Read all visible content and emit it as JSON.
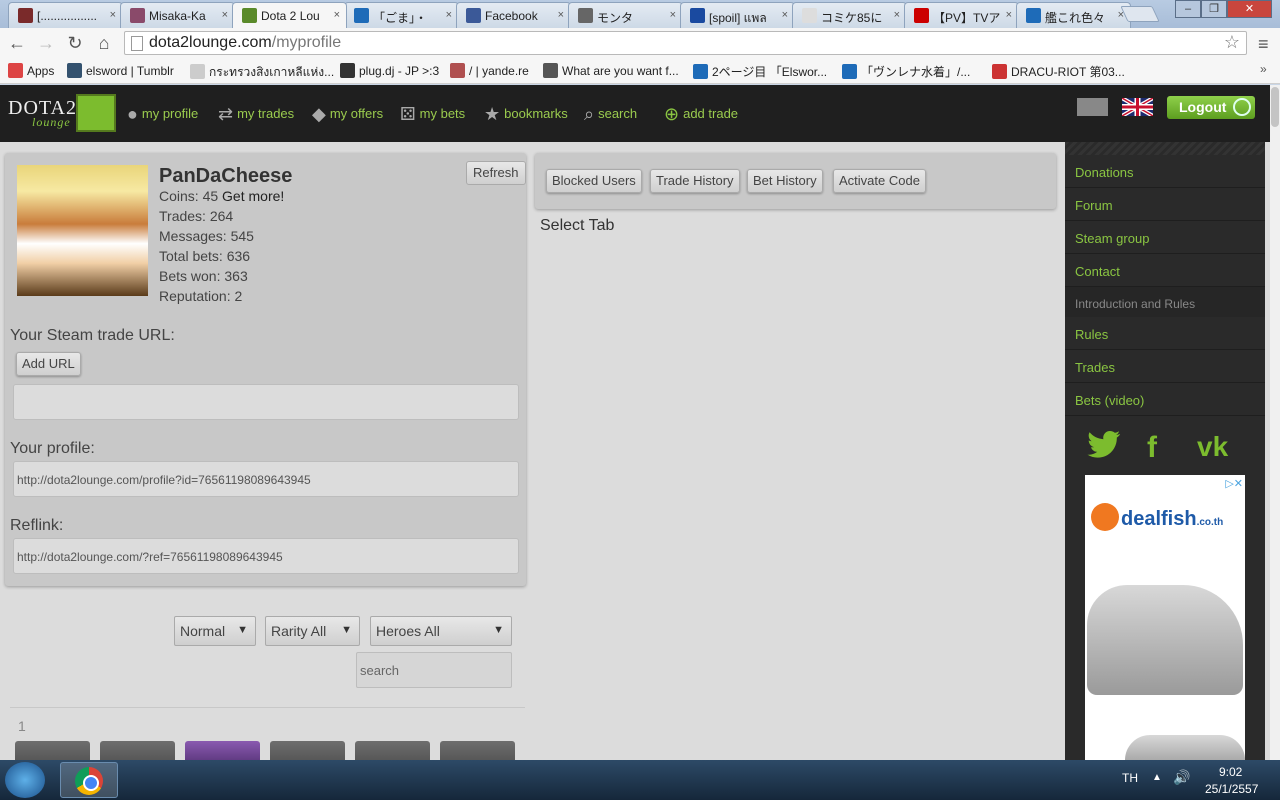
{
  "browser": {
    "tabs": [
      {
        "title": "[.................",
        "color": "#7a2a2a"
      },
      {
        "title": "Misaka-Ka",
        "color": "#8a4a6a"
      },
      {
        "title": "Dota 2 Lou",
        "color": "#5a8a2a"
      },
      {
        "title": "「ごま」・",
        "color": "#1e6bb8"
      },
      {
        "title": "Facebook",
        "color": "#3b5998"
      },
      {
        "title": "モンタ",
        "color": "#666666"
      },
      {
        "title": "[spoil] แพล",
        "color": "#1a4aa0"
      },
      {
        "title": "コミケ85に",
        "color": "#dddddd"
      },
      {
        "title": "【PV】TVア",
        "color": "#cc0000"
      },
      {
        "title": "艦これ色々",
        "color": "#1e6bb8"
      }
    ],
    "url_domain": "dota2lounge.com",
    "url_path": "/myprofile",
    "bookmarks": [
      {
        "label": "Apps",
        "color": "#d44"
      },
      {
        "label": "elsword | Tumblr",
        "color": "#34526f"
      },
      {
        "label": "กระทรวงสิงเกาหลีแห่ง...",
        "color": "#cccccc"
      },
      {
        "label": "plug.dj - JP >:3",
        "color": "#333333"
      },
      {
        "label": "/ | yande.re",
        "color": "#b05050"
      },
      {
        "label": "What are you want f...",
        "color": "#555555"
      },
      {
        "label": "2ページ目 「Elswor...",
        "color": "#1e6bb8"
      },
      {
        "label": "「ヴンレナ水着」/...",
        "color": "#1e6bb8"
      },
      {
        "label": "DRACU-RIOT 第03...",
        "color": "#cc3333"
      }
    ]
  },
  "site": {
    "logo_main": "DOTA2",
    "logo_sub": "lounge",
    "nav": [
      {
        "label": "my profile",
        "icon": "person-icon"
      },
      {
        "label": "my trades",
        "icon": "trades-icon"
      },
      {
        "label": "my offers",
        "icon": "tag-icon"
      },
      {
        "label": "my bets",
        "icon": "dice-icon"
      },
      {
        "label": "bookmarks",
        "icon": "star-icon"
      },
      {
        "label": "search",
        "icon": "search-icon"
      },
      {
        "label": "add trade",
        "icon": "plus-icon"
      }
    ],
    "logout": "Logout"
  },
  "profile": {
    "refresh": "Refresh",
    "username": "PanDaCheese",
    "coins_label": "Coins: 45",
    "get_more": "Get more!",
    "trades": "Trades: 264",
    "messages": "Messages: 545",
    "total_bets": "Total bets: 636",
    "bets_won": "Bets won: 363",
    "reputation": "Reputation: 2",
    "steam_url_label": "Your Steam trade URL:",
    "add_url": "Add URL",
    "your_profile_label": "Your profile:",
    "profile_url": "http://dota2lounge.com/profile?id=76561198089643945",
    "reflink_label": "Reflink:",
    "reflink_url": "http://dota2lounge.com/?ref=76561198089643945"
  },
  "tabs_panel": {
    "buttons": [
      "Blocked Users",
      "Trade History",
      "Bet History",
      "Activate Code"
    ],
    "select_text": "Select Tab"
  },
  "filters": {
    "quality": "Normal",
    "rarity": "Rarity All",
    "heroes": "Heroes All",
    "search_placeholder": "search",
    "page": "1"
  },
  "sidebar": {
    "top": [
      "Donations",
      "Forum",
      "Steam group",
      "Contact"
    ],
    "section_heading": "Introduction and Rules",
    "rules": [
      "Rules",
      "Trades",
      "Bets (video)"
    ],
    "social": [
      {
        "label": "twitter-icon"
      },
      {
        "label": "f"
      },
      {
        "label": "vk"
      }
    ],
    "ad_brand": "dealfish",
    "ad_tld": ".co.th"
  },
  "taskbar": {
    "language": "TH",
    "time": "9:02",
    "date": "25/1/2557"
  }
}
